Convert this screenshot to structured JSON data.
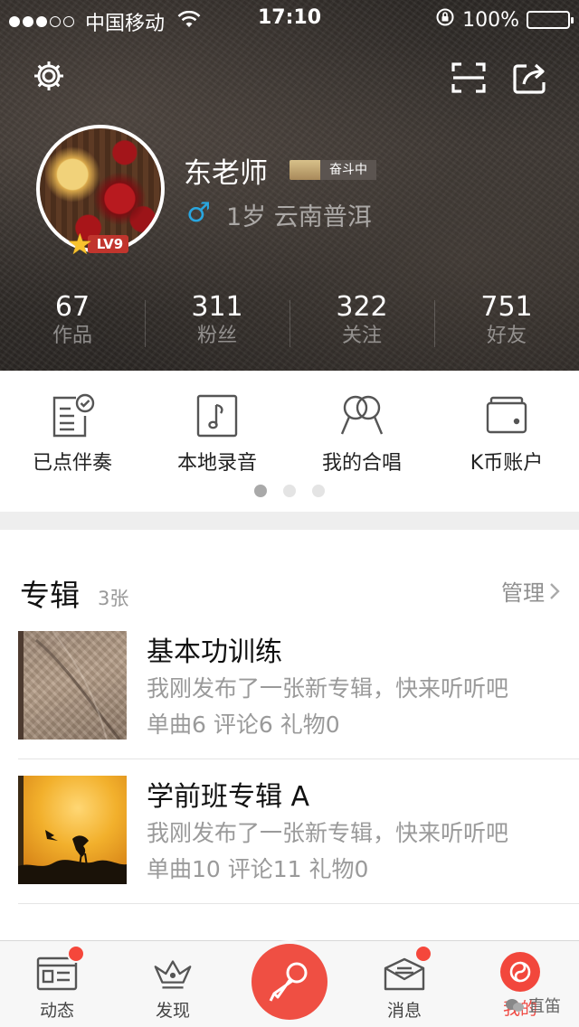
{
  "status_bar": {
    "carrier": "中国移动",
    "time": "17:10",
    "battery": "100%",
    "signal_dots_filled": 3,
    "signal_dots_total": 5
  },
  "header": {
    "settings_icon": "gear-icon",
    "scan_icon": "scan-icon",
    "share_icon": "share-icon"
  },
  "profile": {
    "name": "东老师",
    "rank": "奋斗中",
    "level": "LV9",
    "gender_symbol": "♂",
    "age_location": "1岁 云南普洱"
  },
  "stats": [
    {
      "value": "67",
      "label": "作品"
    },
    {
      "value": "311",
      "label": "粉丝"
    },
    {
      "value": "322",
      "label": "关注"
    },
    {
      "value": "751",
      "label": "好友"
    }
  ],
  "quick_actions": [
    {
      "label": "已点伴奏",
      "icon": "checked-list-icon"
    },
    {
      "label": "本地录音",
      "icon": "music-note-icon"
    },
    {
      "label": "我的合唱",
      "icon": "duet-mic-icon"
    },
    {
      "label": "K币账户",
      "icon": "wallet-icon"
    }
  ],
  "pager": {
    "total": 3,
    "active": 0
  },
  "albums": {
    "title": "专辑",
    "count": "3张",
    "manage_label": "管理",
    "items": [
      {
        "name": "基本功训练",
        "desc": "我刚发布了一张新专辑，快来听听吧",
        "meta": "单曲6  评论6  礼物0"
      },
      {
        "name": "学前班专辑 A",
        "desc": "我刚发布了一张新专辑，快来听听吧",
        "meta": "单曲10  评论11  礼物0"
      }
    ]
  },
  "tabbar": {
    "tabs": [
      {
        "label": "动态",
        "icon": "feed-icon",
        "badge": true
      },
      {
        "label": "发现",
        "icon": "crown-icon",
        "badge": false
      },
      {
        "label": "消息",
        "icon": "mail-icon",
        "badge": true
      },
      {
        "label": "我的",
        "icon": "me-icon",
        "badge": false,
        "active": true
      }
    ],
    "center_icon": "microphone-icon",
    "watermark": "直笛"
  },
  "colors": {
    "accent": "#f04a43",
    "gender_blue": "#29a6df"
  }
}
